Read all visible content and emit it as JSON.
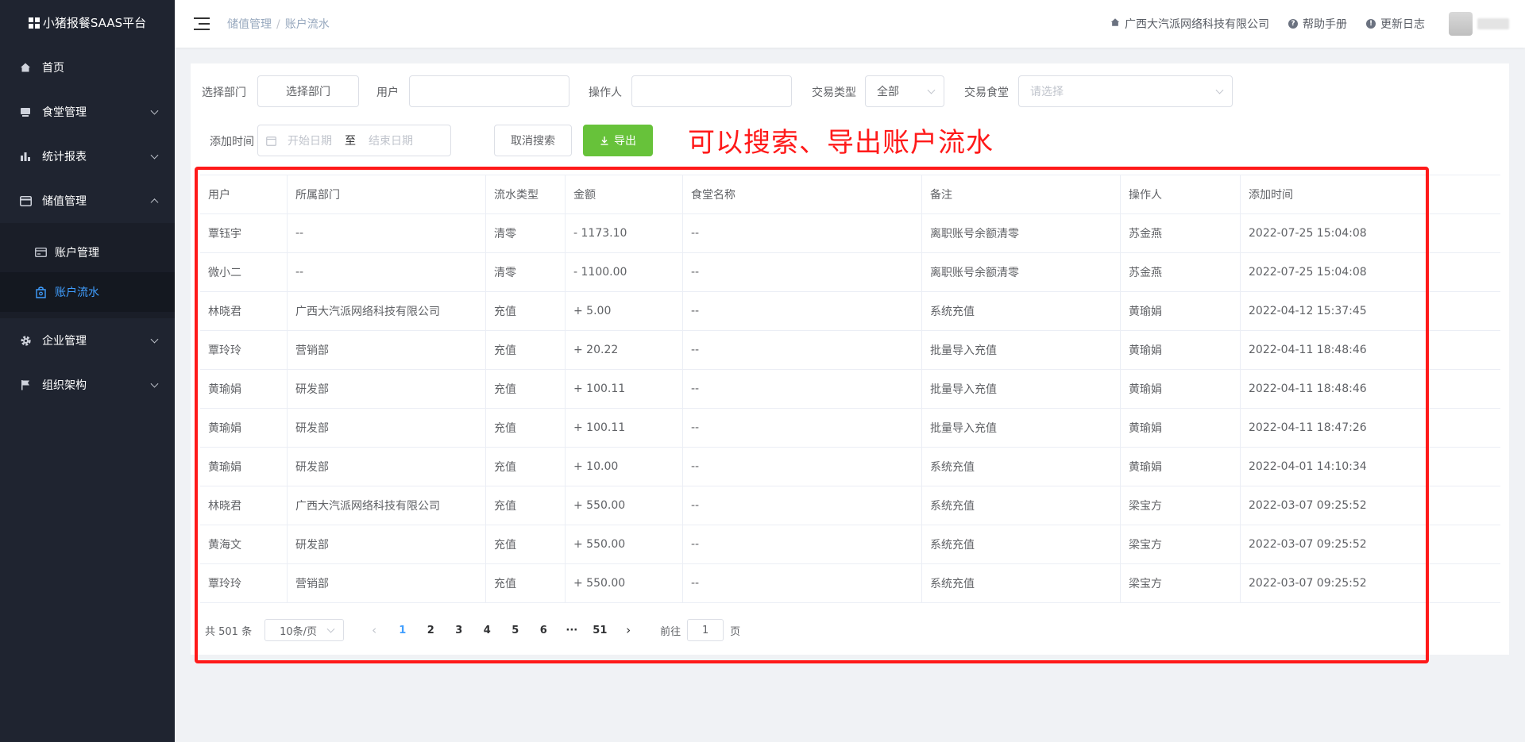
{
  "app": {
    "title": "小猪报餐SAAS平台"
  },
  "sidebar": {
    "items": [
      {
        "label": "首页",
        "icon": "home-icon",
        "expandable": false
      },
      {
        "label": "食堂管理",
        "icon": "canteen-icon",
        "expandable": true
      },
      {
        "label": "统计报表",
        "icon": "bar-chart-icon",
        "expandable": true
      },
      {
        "label": "储值管理",
        "icon": "card-icon",
        "expandable": true,
        "expanded": true
      },
      {
        "label": "企业管理",
        "icon": "gear-icon",
        "expandable": true
      },
      {
        "label": "组织架构",
        "icon": "flag-icon",
        "expandable": true
      }
    ],
    "sub_items": [
      {
        "label": "账户管理",
        "icon": "wallet-icon",
        "active": false
      },
      {
        "label": "账户流水",
        "icon": "bag-icon",
        "active": true
      }
    ]
  },
  "header": {
    "breadcrumb": [
      "储值管理",
      "账户流水"
    ],
    "breadcrumb_sep": "/",
    "company": "广西大汽派网络科技有限公司",
    "help": "帮助手册",
    "changelog": "更新日志"
  },
  "filters": {
    "dept_label": "选择部门",
    "dept_button": "选择部门",
    "user_label": "用户",
    "user_value": "",
    "operator_label": "操作人",
    "operator_value": "",
    "trade_type_label": "交易类型",
    "trade_type_value": "全部",
    "canteen_label": "交易食堂",
    "canteen_placeholder": "请选择",
    "time_label": "添加时间",
    "start_placeholder": "开始日期",
    "range_sep": "至",
    "end_placeholder": "结束日期",
    "cancel_button": "取消搜索",
    "export_button": "导出"
  },
  "annotation": "可以搜索、导出账户流水",
  "table": {
    "columns": [
      "用户",
      "所属部门",
      "流水类型",
      "金额",
      "食堂名称",
      "备注",
      "操作人",
      "添加时间"
    ],
    "rows": [
      [
        "覃钰宇",
        "--",
        "清零",
        "- 1173.10",
        "--",
        "离职账号余额清零",
        "苏金燕",
        "2022-07-25 15:04:08"
      ],
      [
        "微小二",
        "--",
        "清零",
        "- 1100.00",
        "--",
        "离职账号余额清零",
        "苏金燕",
        "2022-07-25 15:04:08"
      ],
      [
        "林晓君",
        "广西大汽派网络科技有限公司",
        "充值",
        "+ 5.00",
        "--",
        "系统充值",
        "黄瑜娟",
        "2022-04-12 15:37:45"
      ],
      [
        "覃玲玲",
        "营销部",
        "充值",
        "+ 20.22",
        "--",
        "批量导入充值",
        "黄瑜娟",
        "2022-04-11 18:48:46"
      ],
      [
        "黄瑜娟",
        "研发部",
        "充值",
        "+ 100.11",
        "--",
        "批量导入充值",
        "黄瑜娟",
        "2022-04-11 18:48:46"
      ],
      [
        "黄瑜娟",
        "研发部",
        "充值",
        "+ 100.11",
        "--",
        "批量导入充值",
        "黄瑜娟",
        "2022-04-11 18:47:26"
      ],
      [
        "黄瑜娟",
        "研发部",
        "充值",
        "+ 10.00",
        "--",
        "系统充值",
        "黄瑜娟",
        "2022-04-01 14:10:34"
      ],
      [
        "林晓君",
        "广西大汽派网络科技有限公司",
        "充值",
        "+ 550.00",
        "--",
        "系统充值",
        "梁宝方",
        "2022-03-07 09:25:52"
      ],
      [
        "黄海文",
        "研发部",
        "充值",
        "+ 550.00",
        "--",
        "系统充值",
        "梁宝方",
        "2022-03-07 09:25:52"
      ],
      [
        "覃玲玲",
        "营销部",
        "充值",
        "+ 550.00",
        "--",
        "系统充值",
        "梁宝方",
        "2022-03-07 09:25:52"
      ]
    ]
  },
  "pagination": {
    "total": "共 501 条",
    "page_size": "10条/页",
    "pages": [
      "1",
      "2",
      "3",
      "4",
      "5",
      "6",
      "···",
      "51"
    ],
    "current": "1",
    "goto_prefix": "前往",
    "goto_value": "1",
    "goto_suffix": "页"
  },
  "colors": {
    "sidebar_bg": "#1f2430",
    "active": "#409eff",
    "export_green": "#67c23a",
    "annotation_red": "#ff1a1a"
  }
}
